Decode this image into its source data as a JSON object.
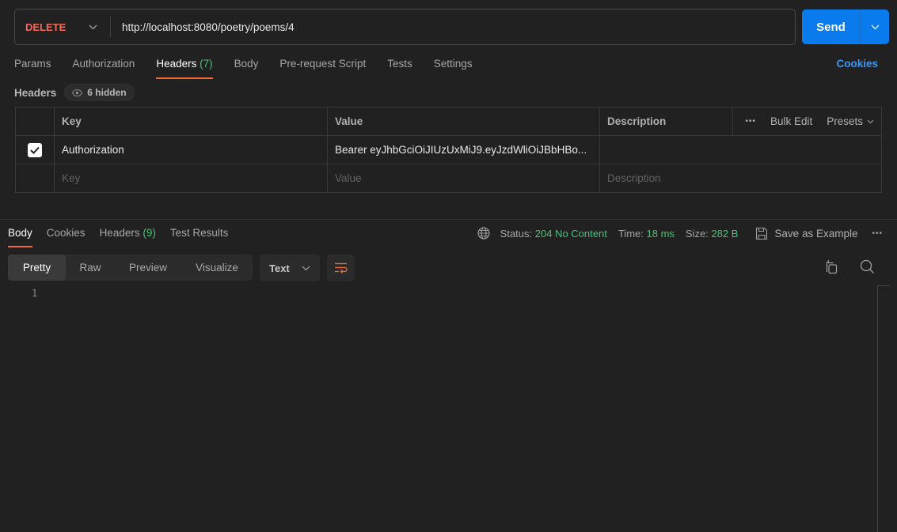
{
  "request": {
    "method": "DELETE",
    "url": "http://localhost:8080/poetry/poems/4",
    "send_label": "Send"
  },
  "request_tabs": [
    {
      "label": "Params",
      "count": ""
    },
    {
      "label": "Authorization",
      "count": ""
    },
    {
      "label": "Headers",
      "count": "(7)",
      "active": true
    },
    {
      "label": "Body",
      "count": ""
    },
    {
      "label": "Pre-request Script",
      "count": ""
    },
    {
      "label": "Tests",
      "count": ""
    },
    {
      "label": "Settings",
      "count": ""
    }
  ],
  "cookies_link": "Cookies",
  "headers_section": {
    "label": "Headers",
    "hidden_label": "6 hidden",
    "columns": {
      "key": "Key",
      "value": "Value",
      "description": "Description"
    },
    "actions": {
      "more": "•••",
      "bulk_edit": "Bulk Edit",
      "presets": "Presets"
    },
    "rows": [
      {
        "enabled": true,
        "key": "Authorization",
        "value": "Bearer eyJhbGciOiJIUzUxMiJ9.eyJzdWliOiJBbHBo...",
        "description": ""
      }
    ],
    "placeholders": {
      "key": "Key",
      "value": "Value",
      "description": "Description"
    }
  },
  "response": {
    "tabs": [
      {
        "label": "Body",
        "count": "",
        "active": true
      },
      {
        "label": "Cookies",
        "count": ""
      },
      {
        "label": "Headers",
        "count": "(9)"
      },
      {
        "label": "Test Results",
        "count": ""
      }
    ],
    "status_label": "Status:",
    "status_value": "204 No Content",
    "time_label": "Time:",
    "time_value": "18 ms",
    "size_label": "Size:",
    "size_value": "282 B",
    "save_example": "Save as Example",
    "more": "•••",
    "view_modes": [
      "Pretty",
      "Raw",
      "Preview",
      "Visualize"
    ],
    "active_view": "Pretty",
    "format": "Text",
    "line_numbers": [
      "1"
    ]
  },
  "colors": {
    "accent": "#f26b3a",
    "method_delete": "#f26b5b",
    "send_button": "#097bed",
    "success": "#49c17a",
    "link": "#3d96f2"
  }
}
